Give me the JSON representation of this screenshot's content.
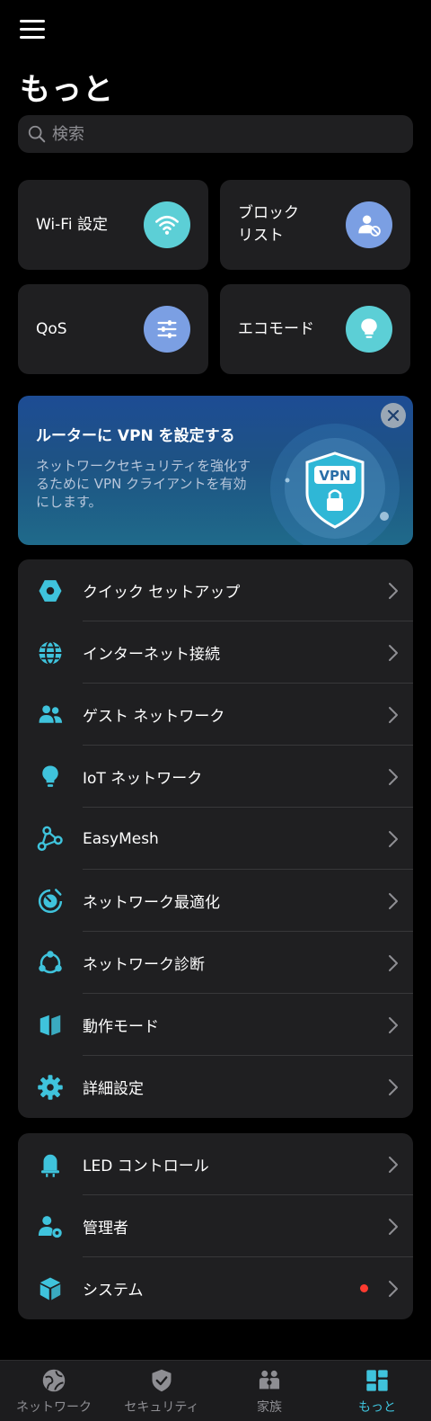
{
  "header": {
    "title": "もっと"
  },
  "search": {
    "placeholder": "検索"
  },
  "tiles": [
    {
      "label": "Wi-Fi 設定",
      "icon": "wifi-icon",
      "color": "#5ccfd6"
    },
    {
      "label": "ブロック\nリスト",
      "icon": "blocked-user-icon",
      "color": "#7b9fe3"
    },
    {
      "label": "QoS",
      "icon": "sliders-icon",
      "color": "#7b9fe3"
    },
    {
      "label": "エコモード",
      "icon": "lightbulb-icon",
      "color": "#5ccfd6"
    }
  ],
  "vpn_banner": {
    "title": "ルーターに VPN を設定する",
    "description": "ネットワークセキュリティを強化するために VPN クライアントを有効にします。",
    "badge": "VPN"
  },
  "settings_list": [
    {
      "label": "クイック セットアップ",
      "icon": "hexagon-icon"
    },
    {
      "label": "インターネット接続",
      "icon": "globe-icon"
    },
    {
      "label": "ゲスト ネットワーク",
      "icon": "guests-icon"
    },
    {
      "label": "IoT ネットワーク",
      "icon": "bulb-icon"
    },
    {
      "label": "EasyMesh",
      "icon": "mesh-icon"
    },
    {
      "label": "ネットワーク最適化",
      "icon": "optimize-icon"
    },
    {
      "label": "ネットワーク診断",
      "icon": "diagnosis-icon"
    },
    {
      "label": "動作モード",
      "icon": "mode-icon"
    },
    {
      "label": "詳細設定",
      "icon": "gear-icon"
    }
  ],
  "system_list": [
    {
      "label": "LED コントロール",
      "icon": "led-icon"
    },
    {
      "label": "管理者",
      "icon": "admin-icon"
    },
    {
      "label": "システム",
      "icon": "cube-icon",
      "has_alert_dot": true
    }
  ],
  "tab_bar": [
    {
      "label": "ネットワーク",
      "icon": "globe-tab-icon",
      "active": false
    },
    {
      "label": "セキュリティ",
      "icon": "shield-tab-icon",
      "active": false
    },
    {
      "label": "家族",
      "icon": "family-tab-icon",
      "active": false
    },
    {
      "label": "もっと",
      "icon": "dashboard-tab-icon",
      "active": true
    }
  ],
  "colors": {
    "accent": "#3fc3dc",
    "card": "#1f1f21",
    "alert": "#ff3b30"
  }
}
